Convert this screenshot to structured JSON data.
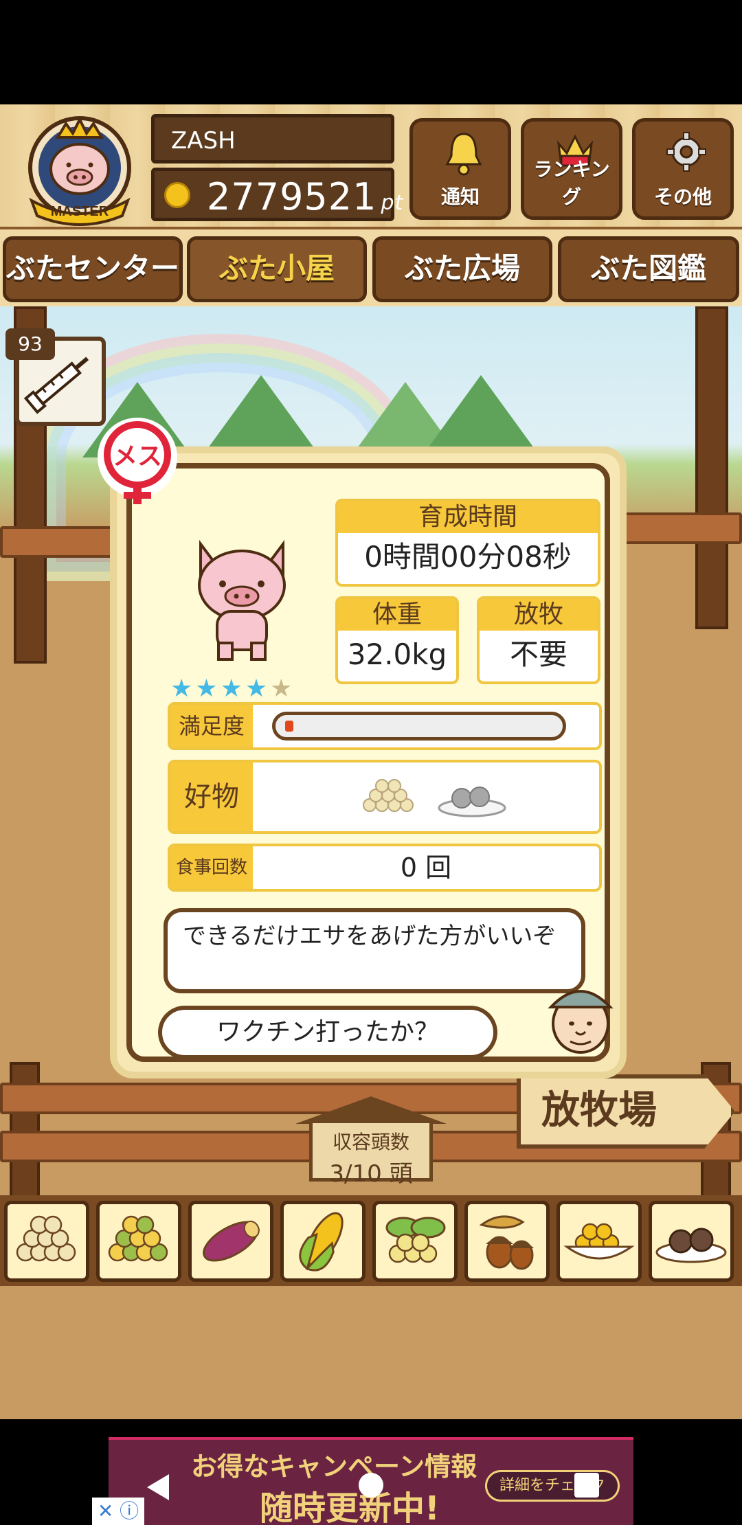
{
  "header": {
    "player_name": "ZASH",
    "points": "2779521",
    "points_unit": "pt",
    "badge_text": "MASTER",
    "buttons": [
      {
        "label": "通知",
        "icon": "bell-icon"
      },
      {
        "label": "ランキング",
        "icon": "crown-icon"
      },
      {
        "label": "その他",
        "icon": "gear-icon"
      }
    ]
  },
  "tabs": [
    {
      "label": "ぶたセンター",
      "active": false
    },
    {
      "label": "ぶた小屋",
      "active": true
    },
    {
      "label": "ぶた広場",
      "active": false
    },
    {
      "label": "ぶた図鑑",
      "active": false
    }
  ],
  "vaccine": {
    "count": "93",
    "icon": "syringe-icon"
  },
  "pig_card": {
    "gender_label": "メス",
    "rating": {
      "filled": 4,
      "total": 5
    },
    "growth_time": {
      "label": "育成時間",
      "value": "0時間00分08秒"
    },
    "weight": {
      "label": "体重",
      "value": "32.0kg"
    },
    "grazing": {
      "label": "放牧",
      "value": "不要"
    },
    "satisfaction": {
      "label": "満足度",
      "level": 0.03
    },
    "favorite": {
      "label": "好物",
      "items": [
        "beans-icon",
        "meatballs-plate-icon"
      ]
    },
    "meals": {
      "label": "食事回数",
      "value": "0 回"
    },
    "message": "できるだけエサをあげた方がいいぞ",
    "question": "ワクチン打ったか？"
  },
  "capacity": {
    "label": "収容頭数",
    "value": "3/10 頭"
  },
  "graze_sign": "放牧場",
  "food_items": [
    "soybeans-icon",
    "mixed-beans-icon",
    "sweet-potato-icon",
    "corn-icon",
    "greens-icon",
    "acorns-icon",
    "grain-bowl-icon",
    "meatballs-plate-icon"
  ],
  "ad": {
    "line1": "お得なキャンペーン情報",
    "line2": "随時更新中!",
    "cta": "詳細をチェック"
  },
  "colors": {
    "wood_dark": "#5b3a1e",
    "gold": "#f7c83a",
    "panel_bg": "#fffbd6",
    "star": "#45b9e6",
    "gender_red": "#e0243a"
  }
}
